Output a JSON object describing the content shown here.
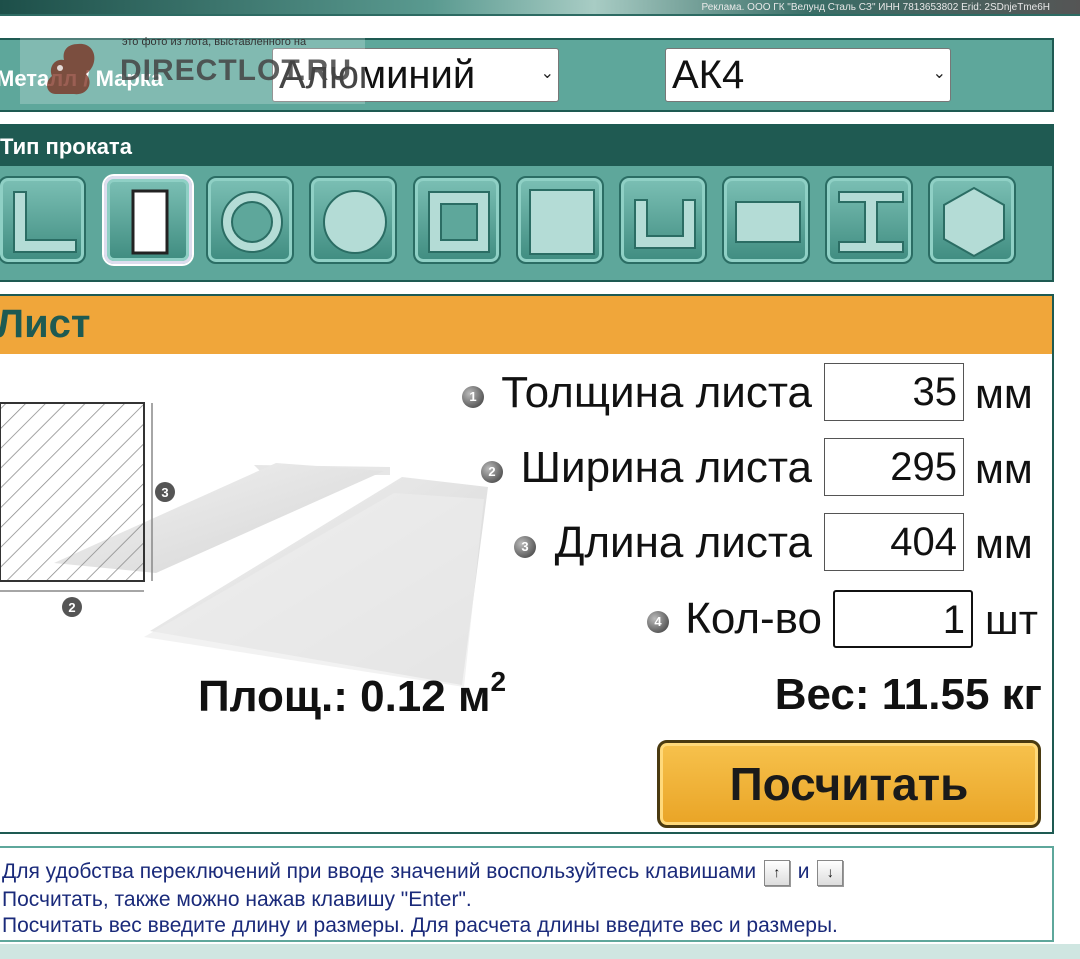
{
  "banner": {
    "ad_text": "Реклама. ООО ГК \"Велунд Сталь СЗ\" ИНН 7813653802 Erid: 2SDnjeTme6H"
  },
  "watermark": {
    "note": "это фото из лота, выставленного на",
    "logo_text": "DIRECTLOT.RU"
  },
  "metal_row": {
    "label": "Металл / Марка",
    "metal_select": {
      "value": "Алюминий",
      "chevron_icon": "chevron-down-icon"
    },
    "grade_select": {
      "value": "АК4",
      "chevron_icon": "chevron-down-icon"
    }
  },
  "profile_types": {
    "header": "Тип проката",
    "buttons": [
      {
        "icon": "angle-profile-icon",
        "selected": false
      },
      {
        "icon": "strip-profile-icon",
        "selected": true
      },
      {
        "icon": "pipe-profile-icon",
        "selected": false
      },
      {
        "icon": "round-bar-icon",
        "selected": false
      },
      {
        "icon": "square-pipe-icon",
        "selected": false
      },
      {
        "icon": "square-bar-icon",
        "selected": false
      },
      {
        "icon": "channel-profile-icon",
        "selected": false
      },
      {
        "icon": "sheet-profile-icon",
        "selected": false
      },
      {
        "icon": "beam-profile-icon",
        "selected": false
      },
      {
        "icon": "hexagon-bar-icon",
        "selected": false
      }
    ]
  },
  "section": {
    "title": "Лист"
  },
  "fields": {
    "thickness": {
      "num": "1",
      "label": "Толщина листа",
      "value": "35",
      "unit": "мм"
    },
    "width": {
      "num": "2",
      "label": "Ширина листа",
      "value": "295",
      "unit": "мм"
    },
    "length": {
      "num": "3",
      "label": "Длина листа",
      "value": "404",
      "unit": "мм"
    },
    "quantity": {
      "num": "4",
      "label": "Кол-во",
      "value": "1",
      "unit": "шт"
    }
  },
  "diagram": {
    "marker_2": "2",
    "marker_3": "3"
  },
  "results": {
    "area_label": "Площ.: 0.12 м",
    "area_sup": "2",
    "weight": "Вес: 11.55 кг"
  },
  "calc_button": {
    "label": "Посчитать"
  },
  "info": {
    "line1_a": "Для удобства переключений при вводе значений воспользуйтесь клавишами",
    "key_up": "↑",
    "line1_and": "и",
    "key_down": "↓",
    "line2": "Посчитать, также можно нажав клавишу \"Enter\".",
    "line3": "Посчитать вес введите длину и размеры. Для расчета длины введите вес и размеры."
  },
  "colors": {
    "panel_teal": "#5ea79b",
    "dark_teal": "#1f5a52",
    "orange": "#f0a63a",
    "info_text": "#1a2a7a"
  }
}
